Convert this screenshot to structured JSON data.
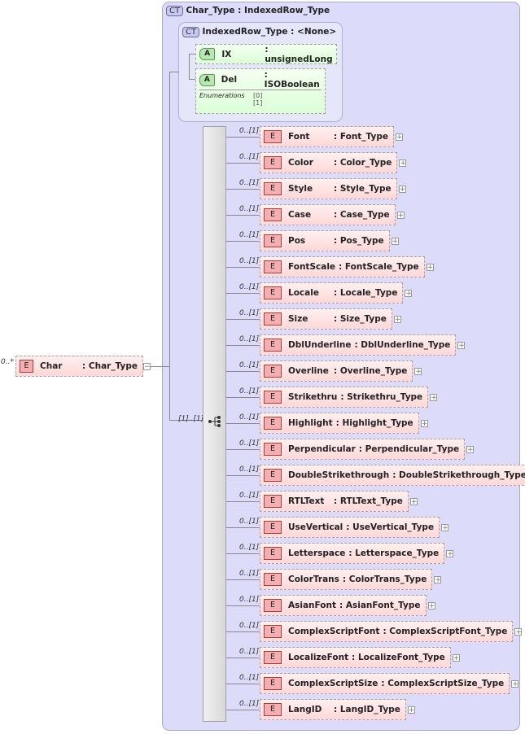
{
  "root": {
    "occurs": "0..*",
    "badge": "E",
    "name": "Char",
    "type": ": Char_Type"
  },
  "complex_type": {
    "badge": "CT",
    "title": "Char_Type : IndexedRow_Type"
  },
  "base_type": {
    "badge": "CT",
    "title": "IndexedRow_Type : <None>",
    "attributes": [
      {
        "badge": "A",
        "name": "IX",
        "type": ": unsignedLong"
      },
      {
        "badge": "A",
        "name": "Del",
        "type": ": ISOBoolean"
      }
    ],
    "enumerations_label": "Enumerations",
    "enumerations": [
      "[0]",
      "[1]"
    ]
  },
  "sequence": {
    "occurs": "[1]..[1]"
  },
  "elements": [
    {
      "occ": "0..[1]",
      "name": "Font",
      "type": ": Font_Type"
    },
    {
      "occ": "0..[1]",
      "name": "Color",
      "type": ": Color_Type"
    },
    {
      "occ": "0..[1]",
      "name": "Style",
      "type": ": Style_Type"
    },
    {
      "occ": "0..[1]",
      "name": "Case",
      "type": ": Case_Type"
    },
    {
      "occ": "0..[1]",
      "name": "Pos",
      "type": ": Pos_Type"
    },
    {
      "occ": "0..[1]",
      "name": "FontScale",
      "type": ": FontScale_Type"
    },
    {
      "occ": "0..[1]",
      "name": "Locale",
      "type": ": Locale_Type"
    },
    {
      "occ": "0..[1]",
      "name": "Size",
      "type": ": Size_Type"
    },
    {
      "occ": "0..[1]",
      "name": "DblUnderline",
      "type": ": DblUnderline_Type"
    },
    {
      "occ": "0..[1]",
      "name": "Overline",
      "type": ": Overline_Type"
    },
    {
      "occ": "0..[1]",
      "name": "Strikethru",
      "type": ": Strikethru_Type"
    },
    {
      "occ": "0..[1]",
      "name": "Highlight",
      "type": ": Highlight_Type"
    },
    {
      "occ": "0..[1]",
      "name": "Perpendicular",
      "type": ": Perpendicular_Type"
    },
    {
      "occ": "0..[1]",
      "name": "DoubleStrikethrough",
      "type": ": DoubleStrikethrough_Type"
    },
    {
      "occ": "0..[1]",
      "name": "RTLText",
      "type": ": RTLText_Type"
    },
    {
      "occ": "0..[1]",
      "name": "UseVertical",
      "type": ": UseVertical_Type"
    },
    {
      "occ": "0..[1]",
      "name": "Letterspace",
      "type": ": Letterspace_Type"
    },
    {
      "occ": "0..[1]",
      "name": "ColorTrans",
      "type": ": ColorTrans_Type"
    },
    {
      "occ": "0..[1]",
      "name": "AsianFont",
      "type": ": AsianFont_Type"
    },
    {
      "occ": "0..[1]",
      "name": "ComplexScriptFont",
      "type": ": ComplexScriptFont_Type"
    },
    {
      "occ": "0..[1]",
      "name": "LocalizeFont",
      "type": ": LocalizeFont_Type"
    },
    {
      "occ": "0..[1]",
      "name": "ComplexScriptSize",
      "type": ": ComplexScriptSize_Type"
    },
    {
      "occ": "0..[1]",
      "name": "LangID",
      "type": ": LangID_Type"
    }
  ],
  "element_badge": "E"
}
